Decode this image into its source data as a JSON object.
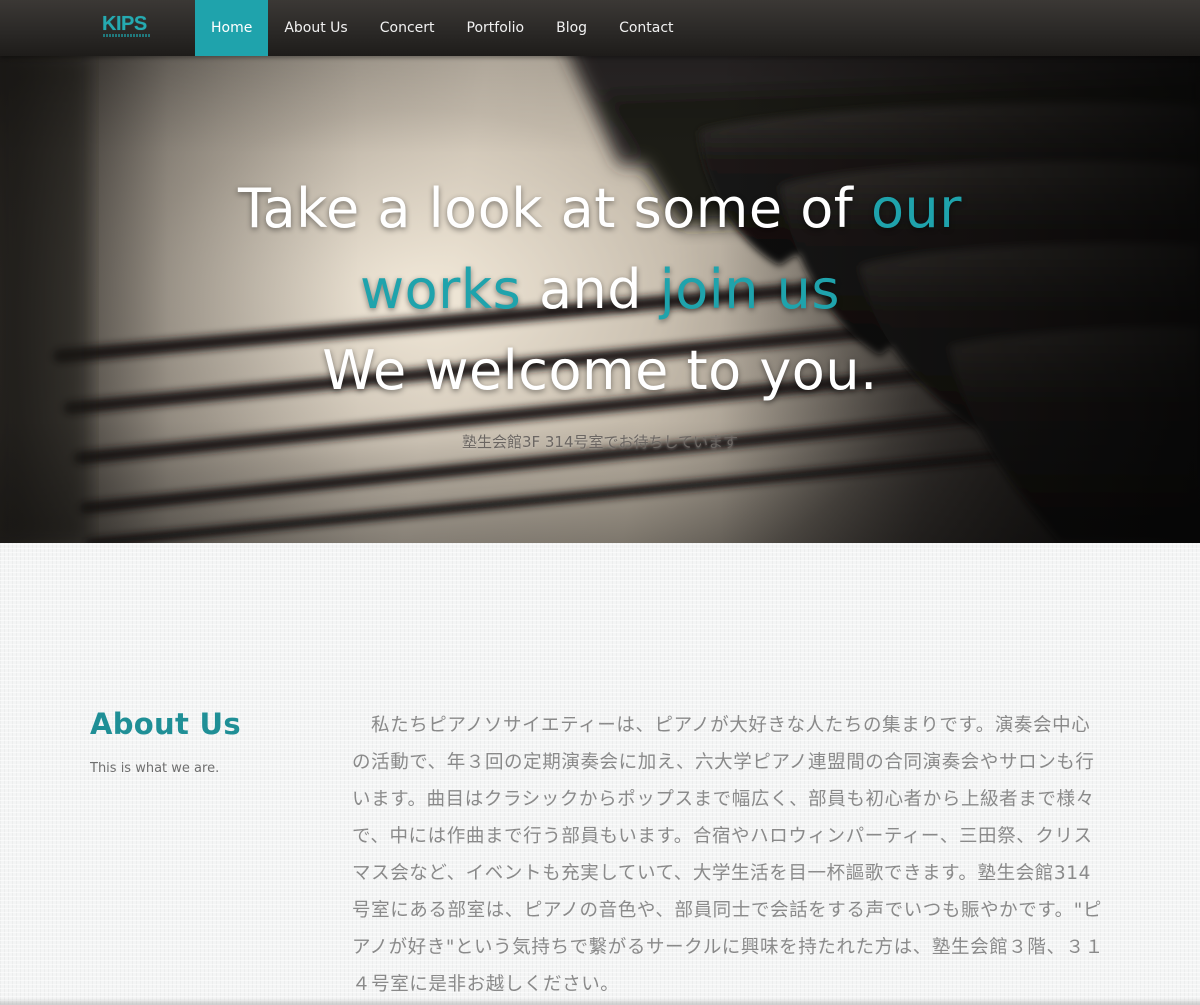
{
  "brand": {
    "logo_text": "KIPS",
    "accent_color": "#1fa3ac"
  },
  "nav": {
    "items": [
      {
        "label": "Home",
        "active": true
      },
      {
        "label": "About Us",
        "active": false
      },
      {
        "label": "Concert",
        "active": false
      },
      {
        "label": "Portfolio",
        "active": false
      },
      {
        "label": "Blog",
        "active": false
      },
      {
        "label": "Contact",
        "active": false
      }
    ]
  },
  "hero": {
    "line1_white": "Take a look at some of ",
    "line1_accent": "our",
    "line2_accent_a": "works",
    "line2_white": " and ",
    "line2_accent_b": "join us",
    "line3": "We welcome to you.",
    "subtitle": "塾生会館3F 314号室でお待ちしています",
    "background_image": "piano-keys"
  },
  "about": {
    "title": "About Us",
    "subtitle": "This is what we are.",
    "body": "私たちピアノソサイエティーは、ピアノが大好きな人たちの集まりです。演奏会中心の活動で、年３回の定期演奏会に加え、六大学ピアノ連盟間の合同演奏会やサロンも行います。曲目はクラシックからポップスまで幅広く、部員も初心者から上級者まで様々で、中には作曲まで行う部員もいます。合宿やハロウィンパーティー、三田祭、クリスマス会など、イベントも充実していて、大学生活を目一杯謳歌できます。塾生会館314号室にある部室は、ピアノの音色や、部員同士で会話をする声でいつも賑やかです。\"ピアノが好き\"という気持ちで繋がるサークルに興味を持たれた方は、塾生会館３階、３１４号室に是非お越しください。"
  }
}
